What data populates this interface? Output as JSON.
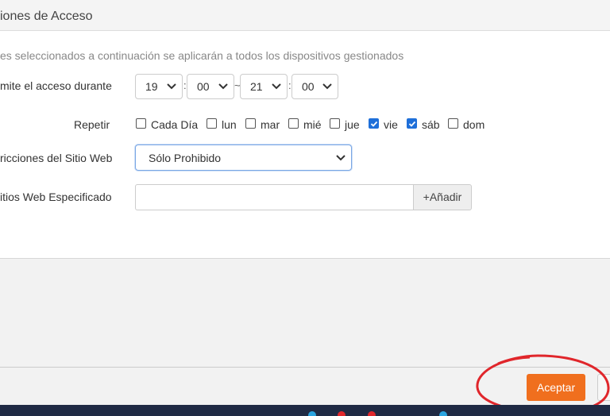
{
  "header": {
    "title": "iones de Acceso"
  },
  "note": "es seleccionados a continuación se aplicarán a todos los dispositivos gestionados",
  "access": {
    "label": "mite el acceso durante",
    "start_hour": "19",
    "start_min": "00",
    "end_hour": "21",
    "end_min": "00",
    "time_sep": ":",
    "range_sep": "~"
  },
  "repeat": {
    "label": "Repetir",
    "options": [
      {
        "label": "Cada Día",
        "checked": false
      },
      {
        "label": "lun",
        "checked": false
      },
      {
        "label": "mar",
        "checked": false
      },
      {
        "label": "mié",
        "checked": false
      },
      {
        "label": "jue",
        "checked": false
      },
      {
        "label": "vie",
        "checked": true
      },
      {
        "label": "sáb",
        "checked": true
      },
      {
        "label": "dom",
        "checked": false
      }
    ]
  },
  "restrictions": {
    "label": "ricciones del Sitio Web",
    "value": "Sólo Prohibido"
  },
  "sites": {
    "label": "itios Web Especificado",
    "input_value": "",
    "add_label": "+Añadir"
  },
  "footer": {
    "accept_label": "Aceptar"
  },
  "colors": {
    "accent": "#f06f1e",
    "checkbox": "#1e6fd9",
    "annotation": "#e0262b"
  }
}
